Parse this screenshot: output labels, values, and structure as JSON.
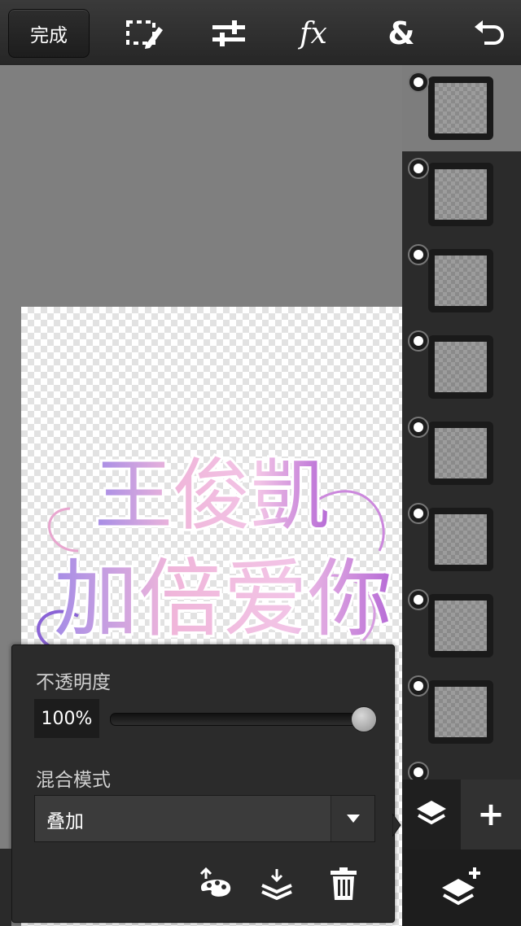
{
  "toolbar": {
    "done_label": "完成",
    "fx_label": "fx",
    "ampersand_label": "&",
    "icons": [
      "selection-edit-icon",
      "adjust-sliders-icon",
      "fx-icon",
      "ampersand-icon",
      "undo-icon"
    ]
  },
  "canvas": {
    "artwork_text_line1": "王俊凱",
    "artwork_text_line2": "加倍爱你"
  },
  "layers": {
    "count_visible": 8,
    "selected_index": 0,
    "visibility_icon": "visibility-dot-icon"
  },
  "panel": {
    "opacity_label": "不透明度",
    "opacity_value": "100%",
    "opacity_fraction": 1.0,
    "blend_label": "混合模式",
    "blend_value": "叠加",
    "action_icons": [
      "palette-export-icon",
      "merge-down-icon",
      "trash-icon"
    ]
  },
  "sidebar_bottom": {
    "plus_label": "+",
    "icons": [
      "layers-icon",
      "plus-icon",
      "add-layer-icon"
    ]
  },
  "colors": {
    "toolbar_bg": "#2f2f2f",
    "panel_bg": "#2b2b2b",
    "selected_layer": "#7d7d7d",
    "artwork_pink": "#e9a6d6",
    "artwork_purple": "#9a6fd8"
  }
}
